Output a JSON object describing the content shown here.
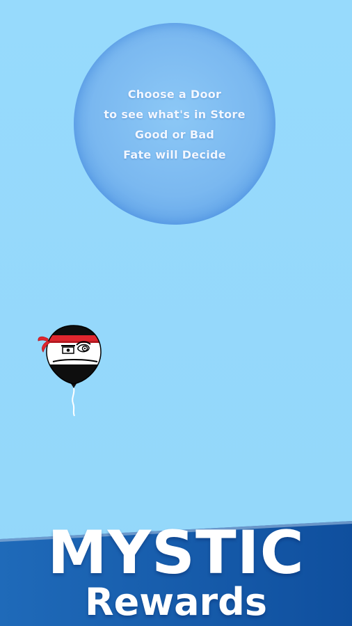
{
  "bubble": {
    "lines": [
      "Choose a Door",
      "to see what's in Store",
      "Good or Bad",
      "Fate will Decide"
    ]
  },
  "player": {
    "icon": "ninja-balloon-icon"
  },
  "banner": {
    "title": "MYSTIC",
    "subtitle": "Rewards"
  },
  "colors": {
    "sky": "#95d9fb",
    "bubble": "#7ab8f0",
    "banner": "#1a5fb0",
    "headband": "#e0262e"
  }
}
